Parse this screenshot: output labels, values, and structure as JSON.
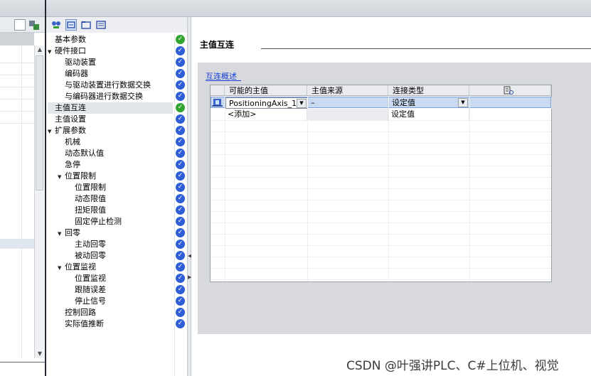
{
  "nav": {
    "items": [
      {
        "label": "基本参数",
        "indent": 0,
        "caret": "",
        "status": "green",
        "selected": false
      },
      {
        "label": "硬件接口",
        "indent": 0,
        "caret": "▼",
        "status": "blue",
        "selected": false
      },
      {
        "label": "驱动装置",
        "indent": 1,
        "caret": "",
        "status": "blue",
        "selected": false
      },
      {
        "label": "编码器",
        "indent": 1,
        "caret": "",
        "status": "blue",
        "selected": false
      },
      {
        "label": "与驱动装置进行数据交换",
        "indent": 1,
        "caret": "",
        "status": "blue",
        "selected": false
      },
      {
        "label": "与编码器进行数据交换",
        "indent": 1,
        "caret": "",
        "status": "blue",
        "selected": false
      },
      {
        "label": "主值互连",
        "indent": 0,
        "caret": "",
        "status": "green",
        "selected": true
      },
      {
        "label": "主值设置",
        "indent": 0,
        "caret": "",
        "status": "blue",
        "selected": false
      },
      {
        "label": "扩展参数",
        "indent": 0,
        "caret": "▼",
        "status": "blue",
        "selected": false
      },
      {
        "label": "机械",
        "indent": 1,
        "caret": "",
        "status": "blue",
        "selected": false
      },
      {
        "label": "动态默认值",
        "indent": 1,
        "caret": "",
        "status": "blue",
        "selected": false
      },
      {
        "label": "急停",
        "indent": 1,
        "caret": "",
        "status": "blue",
        "selected": false
      },
      {
        "label": "位置限制",
        "indent": 1,
        "caret": "▼",
        "status": "blue",
        "selected": false
      },
      {
        "label": "位置限制",
        "indent": 2,
        "caret": "",
        "status": "blue",
        "selected": false
      },
      {
        "label": "动态限值",
        "indent": 2,
        "caret": "",
        "status": "blue",
        "selected": false
      },
      {
        "label": "扭矩限值",
        "indent": 2,
        "caret": "",
        "status": "blue",
        "selected": false
      },
      {
        "label": "固定停止检测",
        "indent": 2,
        "caret": "",
        "status": "blue",
        "selected": false
      },
      {
        "label": "回零",
        "indent": 1,
        "caret": "▼",
        "status": "blue",
        "selected": false
      },
      {
        "label": "主动回零",
        "indent": 2,
        "caret": "",
        "status": "blue",
        "selected": false
      },
      {
        "label": "被动回零",
        "indent": 2,
        "caret": "",
        "status": "blue",
        "selected": false
      },
      {
        "label": "位置监视",
        "indent": 1,
        "caret": "▼",
        "status": "blue",
        "selected": false
      },
      {
        "label": "位置监视",
        "indent": 2,
        "caret": "",
        "status": "blue",
        "selected": false
      },
      {
        "label": "跟随误差",
        "indent": 2,
        "caret": "",
        "status": "blue",
        "selected": false
      },
      {
        "label": "停止信号",
        "indent": 2,
        "caret": "",
        "status": "blue",
        "selected": false
      },
      {
        "label": "控制回路",
        "indent": 1,
        "caret": "",
        "status": "blue",
        "selected": false
      },
      {
        "label": "实际值推断",
        "indent": 1,
        "caret": "",
        "status": "blue",
        "selected": false
      }
    ]
  },
  "main": {
    "section_title": "主值互连",
    "subsection_title": "互连概述",
    "table": {
      "headers": [
        "可能的主值",
        "主值来源",
        "连接类型",
        ""
      ],
      "rows": [
        {
          "master": "PositioningAxis_1",
          "source": "–",
          "type": "设定值"
        },
        {
          "master": "<添加>",
          "source": "",
          "type": "设定值"
        }
      ]
    }
  },
  "watermark": "CSDN @叶强讲PLC、C#上位机、视觉",
  "colors": {
    "status_blue": "#2f5ed8",
    "status_green": "#2fa22f",
    "selected_row": "#c9d9f0",
    "link_blue": "#1a3fd8"
  }
}
